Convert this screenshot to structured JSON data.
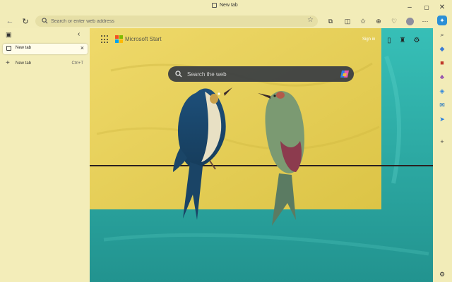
{
  "window": {
    "title": "New tab"
  },
  "address_bar": {
    "placeholder": "Search or enter web address"
  },
  "vertical_tabs": {
    "tabs": [
      {
        "label": "New tab"
      }
    ],
    "new_tab_label": "New tab",
    "new_tab_shortcut": "Ctrl+T"
  },
  "newtab_page": {
    "brand": "Microsoft Start",
    "signin": "Sign in",
    "search_placeholder": "Search the web"
  },
  "colors": {
    "accent_yellow": "#e5cf4f",
    "accent_teal": "#2fb0a8",
    "chrome": "#f2ecb8"
  }
}
